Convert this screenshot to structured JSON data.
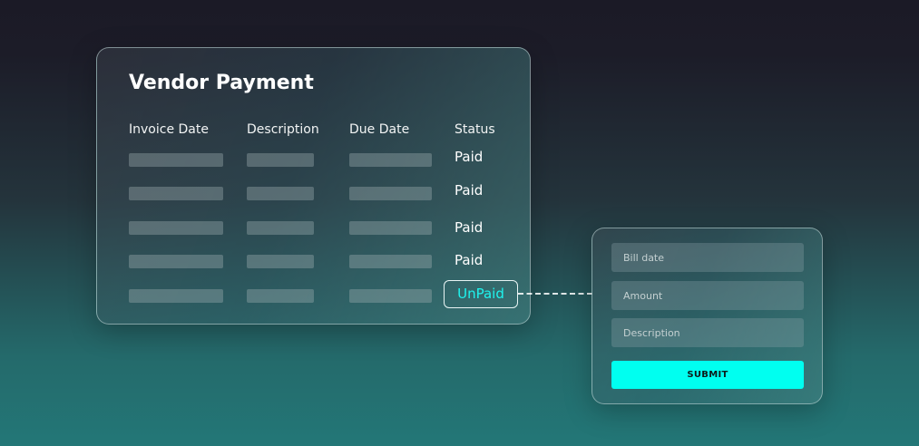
{
  "vendor_payment": {
    "title": "Vendor Payment",
    "columns": [
      "Invoice Date",
      "Description",
      "Due Date",
      "Status"
    ],
    "rows": [
      {
        "status": "Paid"
      },
      {
        "status": "Paid"
      },
      {
        "status": "Paid"
      },
      {
        "status": "Paid"
      },
      {
        "status": "UnPaid"
      }
    ]
  },
  "bill_form": {
    "bill_date_placeholder": "Bill date",
    "amount_placeholder": "Amount",
    "description_placeholder": "Description",
    "submit_label": "SUBMIT"
  },
  "colors": {
    "accent": "#00fff0",
    "unpaid_text": "#1ff4ee"
  }
}
